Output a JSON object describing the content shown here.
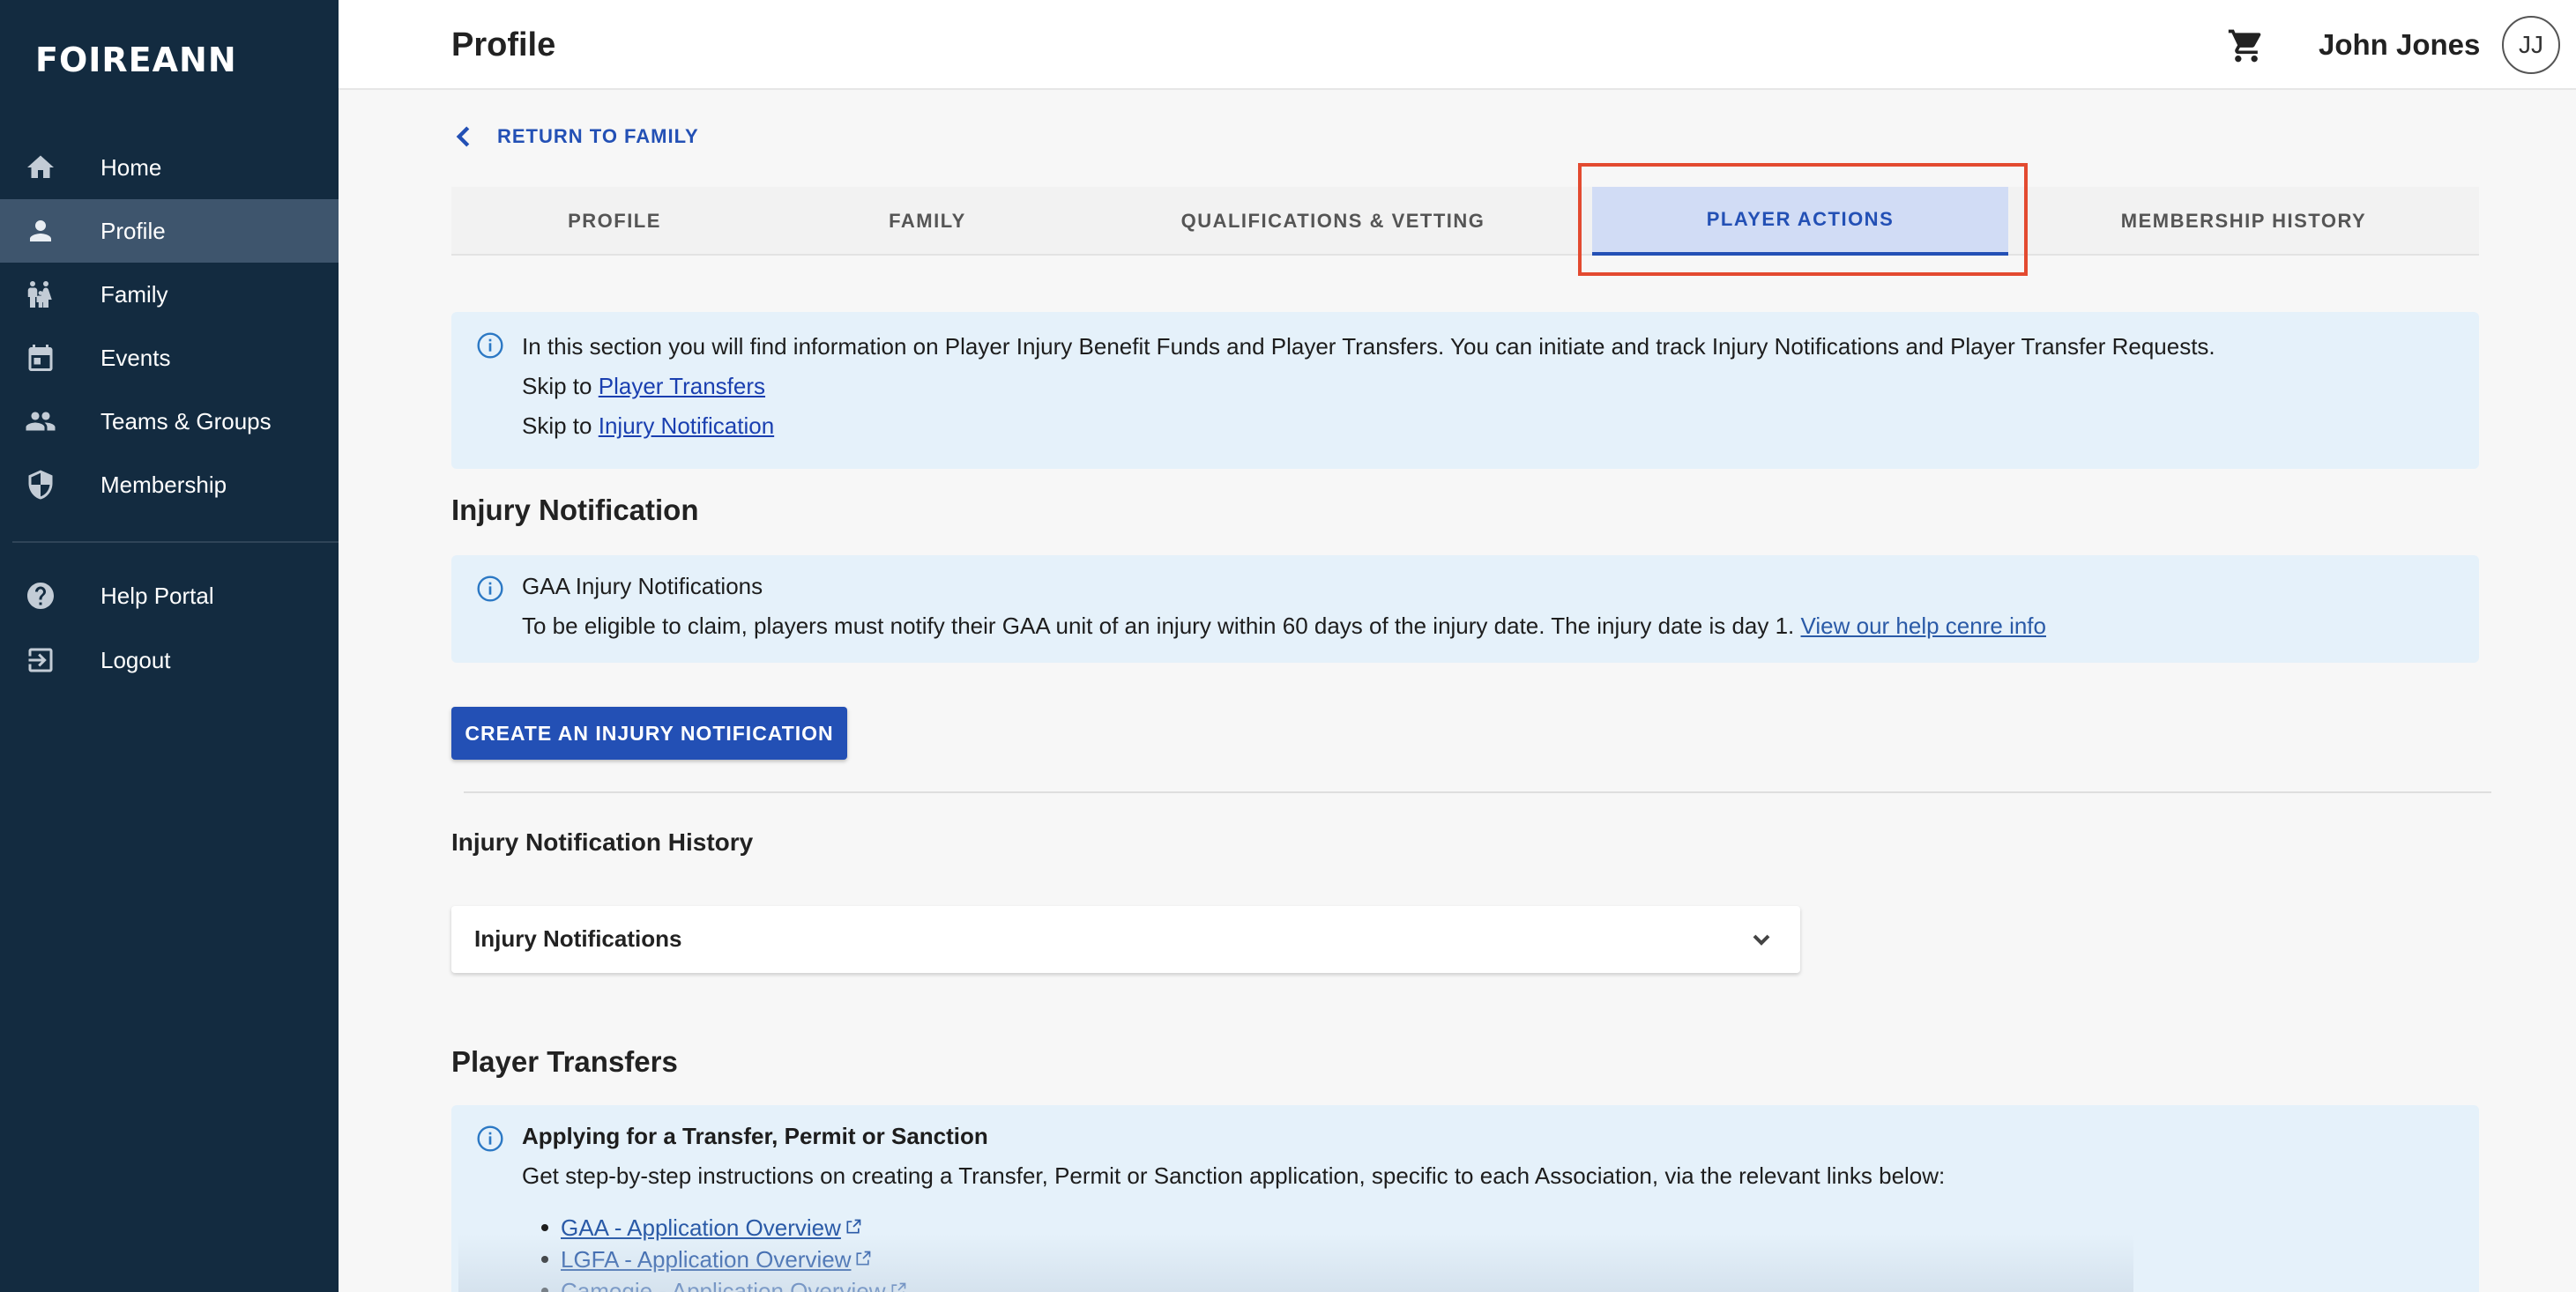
{
  "app": {
    "logo": "FOIREANN"
  },
  "sidebar": {
    "items": [
      {
        "label": "Home",
        "icon": "home-icon"
      },
      {
        "label": "Profile",
        "icon": "person-icon"
      },
      {
        "label": "Family",
        "icon": "family-icon"
      },
      {
        "label": "Events",
        "icon": "calendar-icon"
      },
      {
        "label": "Teams & Groups",
        "icon": "group-icon"
      },
      {
        "label": "Membership",
        "icon": "shield-icon"
      },
      {
        "label": "Help Portal",
        "icon": "help-icon"
      },
      {
        "label": "Logout",
        "icon": "logout-icon"
      }
    ],
    "active": "Profile"
  },
  "header": {
    "title": "Profile",
    "user_name": "John Jones",
    "avatar_initials": "JJ"
  },
  "return_link": "RETURN TO FAMILY",
  "tabs": [
    {
      "label": "PROFILE"
    },
    {
      "label": "FAMILY"
    },
    {
      "label": "QUALIFICATIONS & VETTING"
    },
    {
      "label": "PLAYER ACTIONS"
    },
    {
      "label": "MEMBERSHIP HISTORY"
    }
  ],
  "active_tab": "PLAYER ACTIONS",
  "intro": {
    "text": "In this section you will find information on Player Injury Benefit Funds and Player Transfers. You can initiate and track Injury Notifications and Player Transfer Requests.",
    "skip_prefix": "Skip to",
    "skip_transfers": "Player Transfers",
    "skip_injury": "Injury Notification"
  },
  "injury": {
    "title": "Injury Notification",
    "info_title": "GAA Injury Notifications",
    "info_text": "To be eligible to claim, players must notify their GAA unit of an injury within 60 days of the injury date. The injury date is day 1.",
    "info_link": "View our help cenre info",
    "create_button": "CREATE AN INJURY NOTIFICATION",
    "history_title": "Injury Notification History",
    "accordion_label": "Injury Notifications"
  },
  "transfers": {
    "title": "Player Transfers",
    "info_title": "Applying for a Transfer, Permit or Sanction",
    "info_text": "Get step-by-step instructions on creating a Transfer, Permit or Sanction application, specific to each Association, via the relevant links below:",
    "links": [
      "GAA - Application Overview",
      "LGFA - Application Overview",
      "Camogie - Application Overview"
    ]
  },
  "colors": {
    "sidebar": "#132b40",
    "accent": "#2350b5",
    "highlight": "#e34a30",
    "info_bg": "#e5f1fa"
  }
}
